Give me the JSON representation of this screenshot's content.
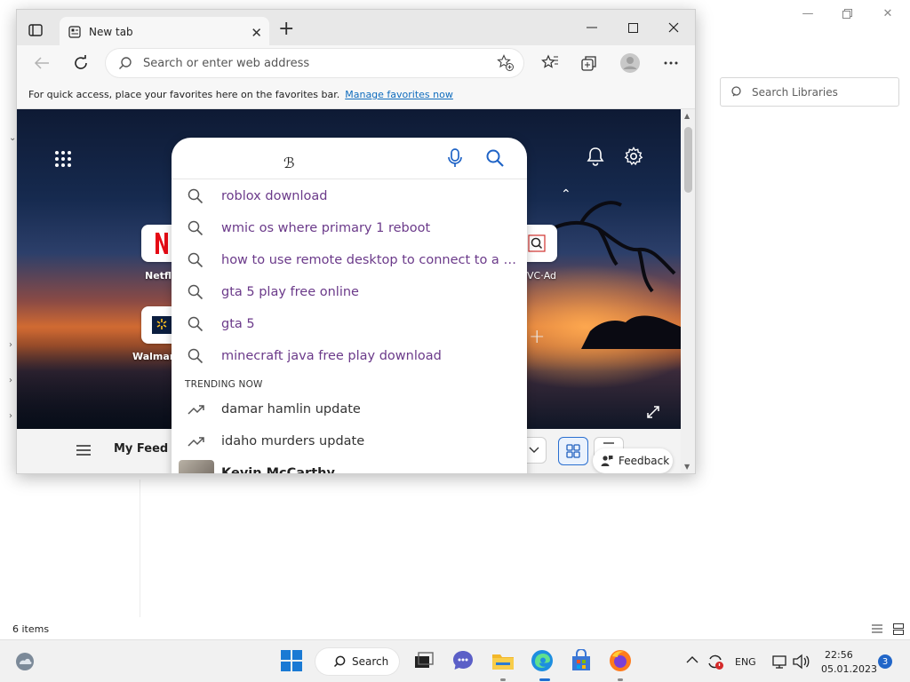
{
  "explorer": {
    "search_placeholder": "Search Libraries",
    "status": "6 items"
  },
  "browser": {
    "tab_title": "New tab",
    "address_placeholder": "Search or enter web address",
    "favorites_message": "For quick access, place your favorites here on the favorites bar.",
    "favorites_link": "Manage favorites now"
  },
  "newtab": {
    "search_suggestions": [
      "roblox download",
      "wmic os where primary 1 reboot",
      "how to use remote desktop to connect to a w...",
      "gta 5 play free online",
      "gta 5",
      "minecraft java free play download"
    ],
    "trending_header": "TRENDING NOW",
    "trending": [
      "damar hamlin update",
      "idaho murders update"
    ],
    "person_result": "Kevin McCarthy",
    "tiles": [
      {
        "label": "Netflix",
        "icon": "netflix-logo"
      },
      {
        "label": "Walmart",
        "icon": "walmart-logo"
      },
      {
        "label": "VC·Ad",
        "icon": "search-icon"
      }
    ],
    "feed_title": "My Feed",
    "feedback_label": "Feedback"
  },
  "taskbar": {
    "search_label": "Search",
    "language": "ENG",
    "time": "22:56",
    "date": "05.01.2023",
    "notification_count": "3"
  },
  "colors": {
    "accent": "#0f6cbd",
    "suggestion_text": "#6b3a8a",
    "taskbar_badge": "#2166c8"
  }
}
